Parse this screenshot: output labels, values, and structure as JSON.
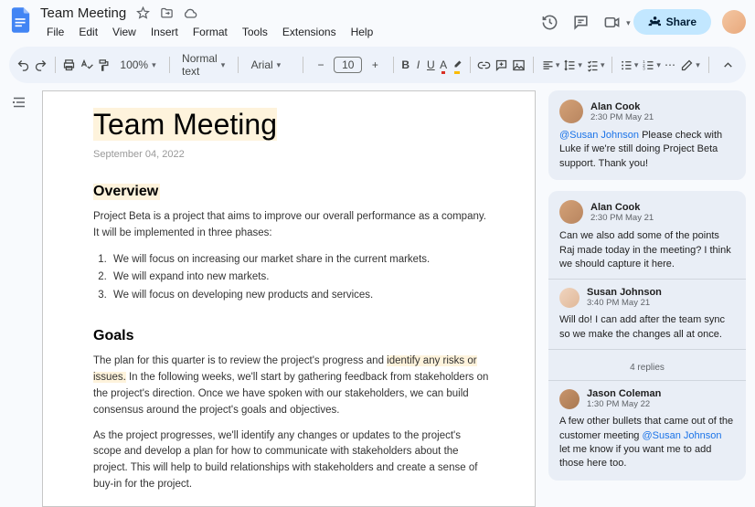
{
  "doc": {
    "title": "Team Meeting",
    "menus": [
      "File",
      "Edit",
      "View",
      "Insert",
      "Format",
      "Tools",
      "Extensions",
      "Help"
    ]
  },
  "header": {
    "share": "Share"
  },
  "toolbar": {
    "zoom": "100%",
    "style": "Normal text",
    "font": "Arial",
    "size": "10"
  },
  "page": {
    "title": "Team Meeting",
    "date": "September 04, 2022",
    "overview_h": "Overview",
    "overview_p": "Project Beta is a project that aims to improve our overall performance as a company. It will be implemented in three phases:",
    "phases": [
      "We will focus on increasing our market share in the current markets.",
      "We will expand into new markets.",
      "We will focus on developing new products and services."
    ],
    "goals_h": "Goals",
    "goals_p1a": "The plan for this quarter is to review the project's progress and ",
    "goals_hl": "identify any risks or issues.",
    "goals_p1b": " In the following weeks, we'll start by gathering feedback from stakeholders on the project's direction. Once we have spoken with our stakeholders, we can build consensus around the project's goals and objectives.",
    "goals_p2": "As the project progresses, we'll identify any changes or updates to the project's scope and develop a plan for how to communicate with stakeholders about the project. This will help to build relationships with stakeholders and create a sense of buy-in for the project."
  },
  "comments": [
    {
      "author": "Alan Cook",
      "time": "2:30 PM May 21",
      "mention": "@Susan Johnson",
      "body": " Please check with Luke if we're still doing Project Beta support. Thank you!"
    },
    {
      "author": "Alan Cook",
      "time": "2:30 PM May 21",
      "body": "Can we also add some of the points Raj made today in the meeting? I think we should capture it here.",
      "reply1_author": "Susan Johnson",
      "reply1_time": "3:40 PM May 21",
      "reply1_body": "Will do! I can add after the team sync so we make the changes all at once.",
      "replies_label": "4 replies",
      "reply2_author": "Jason Coleman",
      "reply2_time": "1:30 PM May 22",
      "reply2_body_a": "A few other bullets that came out of the customer meeting ",
      "reply2_mention": "@Susan Johnson",
      "reply2_body_b": " let me know if you want me to add those here too."
    }
  ]
}
